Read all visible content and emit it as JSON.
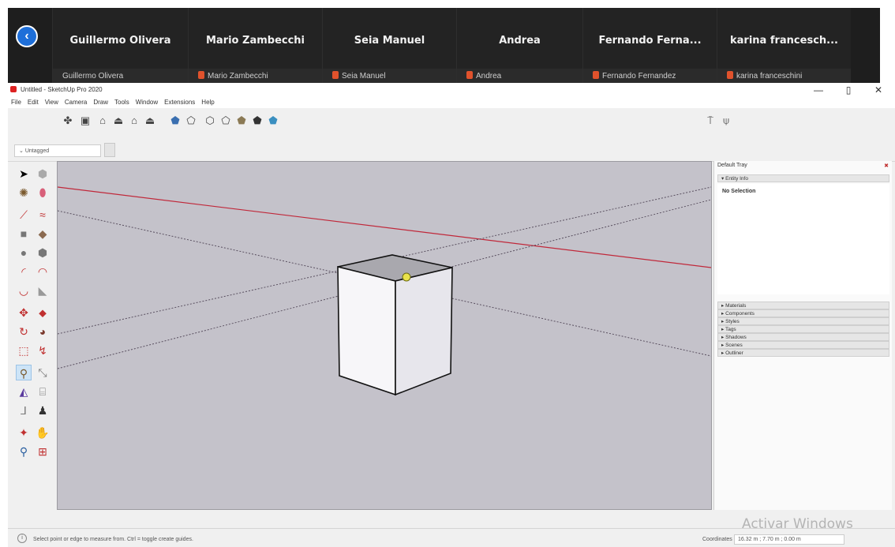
{
  "call": {
    "participants": [
      {
        "name": "Guillermo Olivera",
        "label": "Guillermo Olivera",
        "muted": false
      },
      {
        "name": "Mario Zambecchi",
        "label": "Mario Zambecchi",
        "muted": true
      },
      {
        "name": "Seia Manuel",
        "label": "Seia Manuel",
        "muted": true
      },
      {
        "name": "Andrea",
        "label": "Andrea",
        "muted": true
      },
      {
        "name": "Fernando Ferna...",
        "label": "Fernando Fernandez",
        "muted": true
      },
      {
        "name": "karina francesch...",
        "label": "karina franceschini",
        "muted": true
      }
    ],
    "back_icon": "chevron-left-icon"
  },
  "window": {
    "title": "Untitled - SketchUp Pro 2020",
    "controls": {
      "minimize": "—",
      "maximize": "▯",
      "close": "✕"
    }
  },
  "menu": [
    "File",
    "Edit",
    "View",
    "Camera",
    "Draw",
    "Tools",
    "Window",
    "Extensions",
    "Help"
  ],
  "tags": {
    "selected": "Untagged"
  },
  "tray": {
    "title": "Default Tray",
    "entity_info": {
      "header": "▾ Entity Info",
      "body": "No Selection"
    },
    "panels": [
      "▸ Materials",
      "▸ Components",
      "▸ Styles",
      "▸ Tags",
      "▸ Shadows",
      "▸ Scenes",
      "▸ Outliner"
    ]
  },
  "status": {
    "info_icon": "i",
    "text": "Select point or edge to measure from.  Ctrl = toggle create guides.",
    "coords_label": "Coordinates",
    "coords_value": "16.32 m ; 7.70 m ; 0.00 m"
  },
  "watermark": "Activar Windows",
  "colors": {
    "viewport_bg": "#c4c2ca",
    "red_axis": "#c0283a",
    "call_bg": "#1e1e1e",
    "back_button": "#1e6fd9",
    "mic_muted": "#e0522c"
  }
}
